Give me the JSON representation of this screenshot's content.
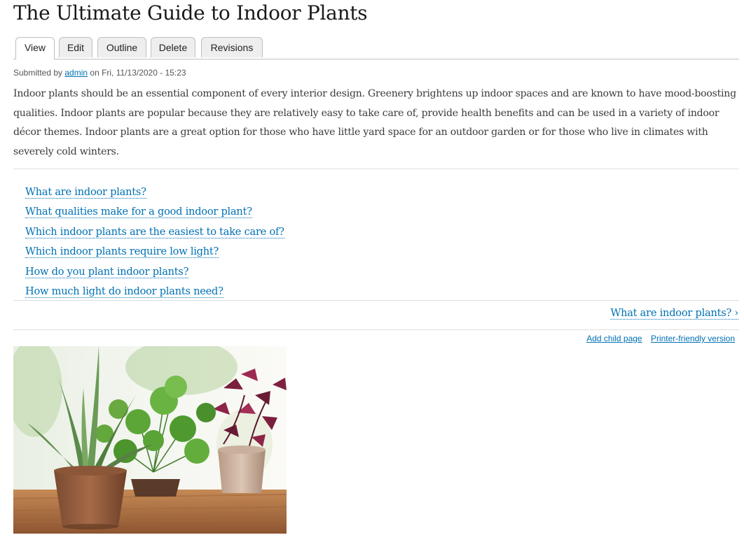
{
  "page": {
    "title": "The Ultimate Guide to Indoor Plants"
  },
  "tabs": [
    {
      "label": "View",
      "active": true
    },
    {
      "label": "Edit",
      "active": false
    },
    {
      "label": "Outline",
      "active": false
    },
    {
      "label": "Delete",
      "active": false
    },
    {
      "label": "Revisions",
      "active": false
    }
  ],
  "meta": {
    "prefix": "Submitted by ",
    "author": "admin",
    "suffix": " on Fri, 11/13/2020 - 15:23"
  },
  "body": {
    "intro": "Indoor plants should be an essential component of every interior design. Greenery brightens up indoor spaces and are known to have mood-boosting qualities. Indoor plants are popular because they are relatively easy to take care of, provide health benefits and can be used in a variety of indoor décor themes. Indoor plants are a great option for those who have little yard space for an outdoor garden or for those who live in climates with severely cold winters."
  },
  "book_toc": [
    "What are indoor plants?",
    "What qualities make for a good indoor plant?",
    "Which indoor plants are the easiest to take care of?",
    "Which indoor plants require low light?",
    "How do you plant indoor plants?",
    "How much light do indoor plants need?"
  ],
  "book_nav": {
    "next": "What are indoor plants? ›"
  },
  "links": {
    "add_child": "Add child page",
    "printer": "Printer-friendly version"
  },
  "image": {
    "subject": "potted-indoor-plants-photo"
  },
  "colors": {
    "link": "#0071b3",
    "text": "#3b3b3b",
    "tab_bg": "#eeeeee",
    "border": "#bfbfbf"
  }
}
